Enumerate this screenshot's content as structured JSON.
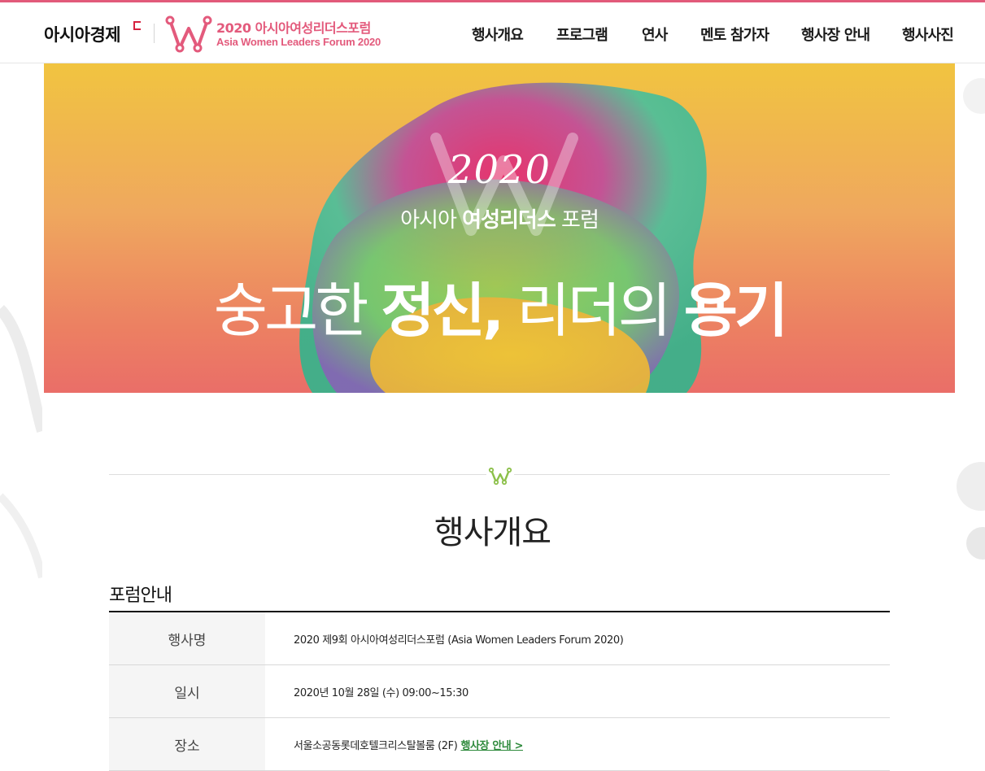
{
  "header": {
    "brand": "아시아경제",
    "forum_title": "2020 아시아여성리더스포럼",
    "forum_subtitle": "Asia Women Leaders Forum 2020"
  },
  "nav": {
    "items": [
      {
        "label": "행사개요"
      },
      {
        "label": "프로그램"
      },
      {
        "label": "연사"
      },
      {
        "label": "멘토 참가자"
      },
      {
        "label": "행사장 안내"
      },
      {
        "label": "행사사진"
      }
    ]
  },
  "hero": {
    "year": "2020",
    "forum_light_pre": "아시아 ",
    "forum_bold": "여성리더스",
    "forum_light_post": " 포럼",
    "slogan_1": "숭고한 ",
    "slogan_2_bold": "정신,",
    "slogan_3": " 리더의 ",
    "slogan_4_bold": "용기"
  },
  "section": {
    "title": "행사개요",
    "subtitle": "포럼안내"
  },
  "info_table": {
    "rows": [
      {
        "label": "행사명",
        "value": "2020 제9회 아시아여성리더스포럼 (Asia Women Leaders Forum 2020)"
      },
      {
        "label": "일시",
        "value": "2020년 10월 28일 (수) 09:00~15:30"
      },
      {
        "label": "장소",
        "value": "서울소공동롯데호텔크리스탈볼룸 (2F)",
        "link": "행사장 안내 >"
      }
    ]
  },
  "colors": {
    "accent_pink": "#e35a7c",
    "link_green": "#2e8a3c",
    "section_icon_green": "#8cc04a"
  }
}
